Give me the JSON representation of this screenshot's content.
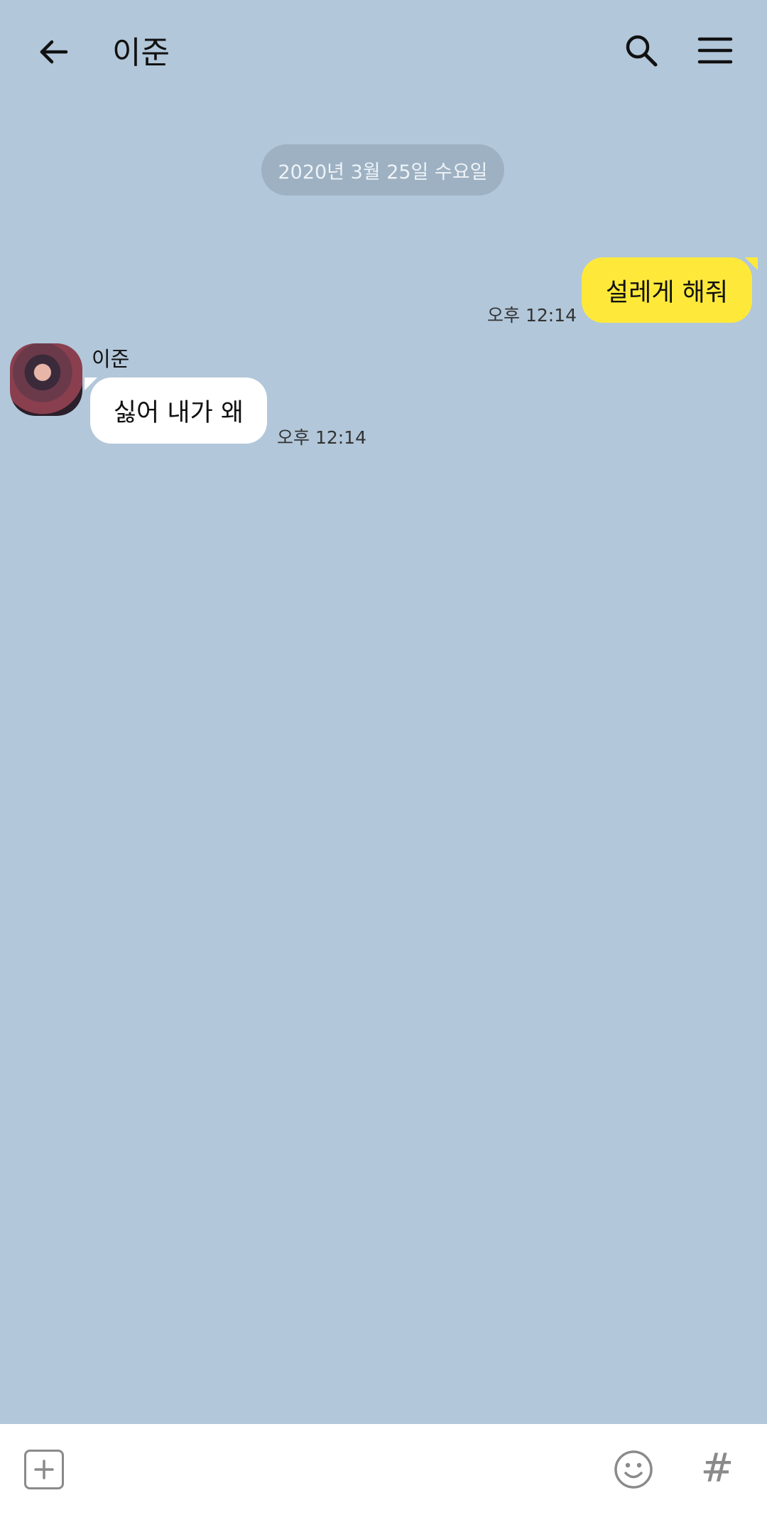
{
  "header": {
    "title": "이준",
    "back_icon": "arrow-left-icon",
    "search_icon": "search-icon",
    "menu_icon": "hamburger-menu-icon"
  },
  "date_divider": "2020년 3월 25일 수요일",
  "messages": [
    {
      "sender": "me",
      "text": "설레게 해줘",
      "time": "오후 12:14",
      "bubble_color": "#fee93b"
    },
    {
      "sender": "이준",
      "text": "싫어 내가 왜",
      "time": "오후 12:14",
      "bubble_color": "#ffffff"
    }
  ],
  "input_bar": {
    "plus_icon": "plus-box-icon",
    "emoji_icon": "emoji-icon",
    "hash_symbol": "#"
  },
  "colors": {
    "background": "#b2c7da",
    "my_bubble": "#fee93b",
    "their_bubble": "#ffffff"
  }
}
